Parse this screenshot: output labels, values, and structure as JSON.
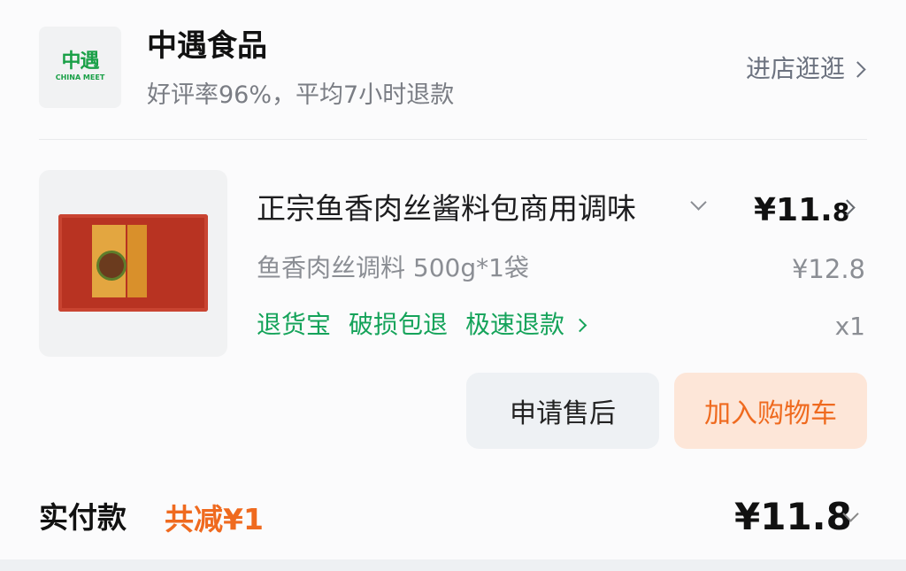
{
  "shop": {
    "logo_zh": "中遇",
    "logo_en": "CHINA MEET",
    "name": "中遇食品",
    "subtitle": "好评率96%，平均7小时退款",
    "visit_label": "进店逛逛"
  },
  "product": {
    "title": "正宗鱼香肉丝酱料包商用调味",
    "price_main": "¥11.",
    "price_decimal": "8",
    "spec": "鱼香肉丝调料 500g*1袋",
    "original_price": "¥12.8",
    "tags": [
      "退货宝",
      "破损包退",
      "极速退款"
    ],
    "quantity": "x1"
  },
  "actions": {
    "after_sale": "申请售后",
    "add_cart": "加入购物车"
  },
  "payment": {
    "label": "实付款",
    "discount": "共减¥1",
    "amount": "¥11.8"
  },
  "colors": {
    "accent_green": "#15a35a",
    "accent_orange": "#ef6a1f",
    "logo_green": "#1aa047"
  }
}
